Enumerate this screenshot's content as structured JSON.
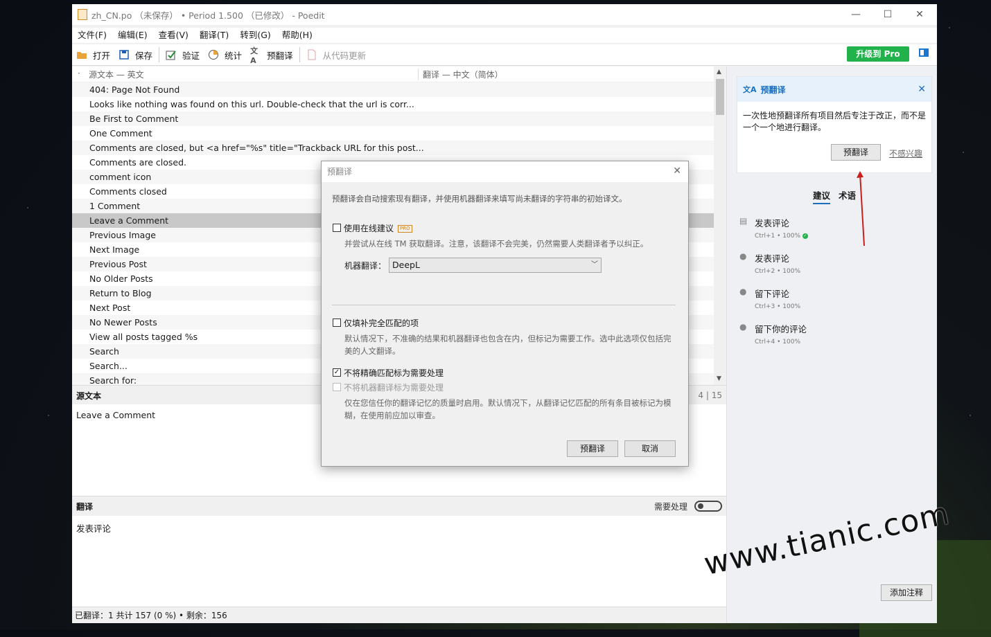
{
  "window": {
    "title": "zh_CN.po （未保存） • Period 1.500 （已修改） - Poedit"
  },
  "menu": [
    "文件(F)",
    "编辑(E)",
    "查看(V)",
    "翻译(T)",
    "转到(G)",
    "帮助(H)"
  ],
  "toolbar": {
    "open": "打开",
    "save": "保存",
    "validate": "验证",
    "stats": "统计",
    "pretranslate": "预翻译",
    "update_from_code": "从代码更新",
    "upgrade": "升级到 Pro"
  },
  "list": {
    "col_source": "源文本 — 英文",
    "col_translation": "翻译 — 中文（简体）",
    "rows": [
      "404: Page Not Found",
      "Looks like nothing was found on this url.  Double-check that the url is corr...",
      "Be First to Comment",
      "One Comment",
      "Comments are closed, but <a href=\"%s\" title=\"Trackback URL for this post...",
      "Comments are closed.",
      "comment icon",
      "Comments closed",
      "1 Comment",
      "Leave a Comment",
      "Previous Image",
      "Next Image",
      "Previous Post",
      "No Older Posts",
      "Return to Blog",
      "Next Post",
      "No Newer Posts",
      "View all posts tagged %s",
      "Search",
      "Search...",
      "Search for:"
    ],
    "selected_index": 9
  },
  "source_panel": {
    "title": "源文本",
    "counter": "4 | 15",
    "text": "Leave a Comment"
  },
  "translation_panel": {
    "title": "翻译",
    "needs_work_label": "需要处理",
    "text": "发表评论"
  },
  "status": {
    "text": "已翻译：1 共计 157 (0 %)  •  剩余：156"
  },
  "sidebar": {
    "tip_title": "预翻译",
    "tip_text": "一次性地预翻译所有项目然后专注于改正，而不是一个一个地进行翻译。",
    "tip_button": "预翻译",
    "tip_dismiss": "不感兴趣",
    "tab_suggestions": "建议",
    "tab_terms": "术语",
    "suggestions": [
      {
        "text": "发表评论",
        "meta": "Ctrl+1 • 100%",
        "icon": "database-icon"
      },
      {
        "text": "发表评论",
        "meta": "Ctrl+2 • 100%",
        "icon": "person-icon"
      },
      {
        "text": "留下评论",
        "meta": "Ctrl+3 • 100%",
        "icon": "person-icon"
      },
      {
        "text": "留下你的评论",
        "meta": "Ctrl+4 • 100%",
        "icon": "person-icon"
      }
    ],
    "add_comment": "添加注释"
  },
  "dialog": {
    "title": "预翻译",
    "description": "预翻译会自动搜索现有翻译，并使用机器翻译来填写尚未翻译的字符串的初始译文。",
    "online_label": "使用在线建议",
    "pro_badge": "PRO",
    "online_hint": "并尝试从在线 TM 获取翻译。注意，该翻译不会完美，仍然需要人类翻译者予以纠正。",
    "mt_label": "机器翻译：",
    "mt_value": "DeepL",
    "exact_label": "仅填补完全匹配的项",
    "exact_hint": "默认情况下，不准确的结果和机器翻译也包含在内，但标记为需要工作。选中此选项仅包括完美的人文翻译。",
    "fuzzy_label": "不将精确匹配标为需要处理",
    "mt_fuzzy_label": "不将机器翻译标为需要处理",
    "tm_hint": "仅在您信任你的翻译记忆的质量时启用。默认情况下，从翻译记忆匹配的所有条目被标记为模糊，在使用前应加以审查。",
    "ok": "预翻译",
    "cancel": "取消"
  },
  "watermark": "www.tianic.com"
}
